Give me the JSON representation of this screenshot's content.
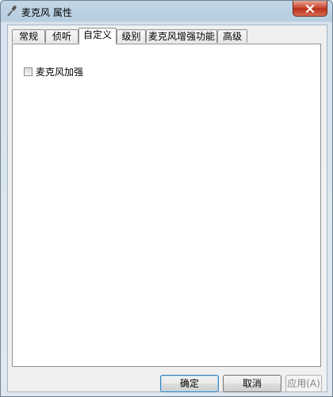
{
  "window": {
    "title": "麦克风 属性"
  },
  "tabs": [
    {
      "label": "常规"
    },
    {
      "label": "侦听"
    },
    {
      "label": "自定义"
    },
    {
      "label": "级别"
    },
    {
      "label": "麦克风增强功能"
    },
    {
      "label": "高级"
    }
  ],
  "active_tab": "自定义",
  "panel": {
    "checkbox_label": "麦克风加强",
    "checkbox_checked": false
  },
  "buttons": {
    "ok": "确定",
    "cancel": "取消",
    "apply": "应用(A)"
  },
  "icons": {
    "title_icon": "microphone-icon",
    "close_icon": "close-icon"
  }
}
